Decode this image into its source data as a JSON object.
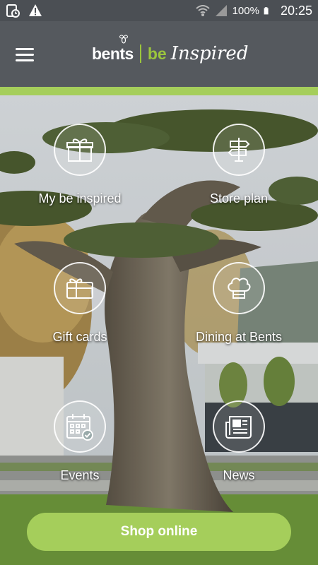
{
  "status_bar": {
    "battery_percent": "100%",
    "time": "20:25",
    "icons": [
      "notification-icon",
      "warning-icon",
      "wifi-icon",
      "signal-icon",
      "battery-icon"
    ]
  },
  "header": {
    "logo_brand": "bents",
    "logo_be": "be",
    "logo_inspired": "Inspired",
    "menu_icon": "hamburger-menu-icon"
  },
  "colors": {
    "header": "#55595e",
    "status_bar": "#4b4f54",
    "accent": "#a5ce5b",
    "logo_green": "#9bc53d"
  },
  "tiles": [
    {
      "label": "My be inspired",
      "icon": "gift-box-icon"
    },
    {
      "label": "Store plan",
      "icon": "signpost-icon"
    },
    {
      "label": "Gift cards",
      "icon": "gift-card-icon"
    },
    {
      "label": "Dining at Bents",
      "icon": "chef-hat-icon"
    },
    {
      "label": "Events",
      "icon": "calendar-icon"
    },
    {
      "label": "News",
      "icon": "newspaper-icon"
    }
  ],
  "shop_button": {
    "label": "Shop online"
  }
}
